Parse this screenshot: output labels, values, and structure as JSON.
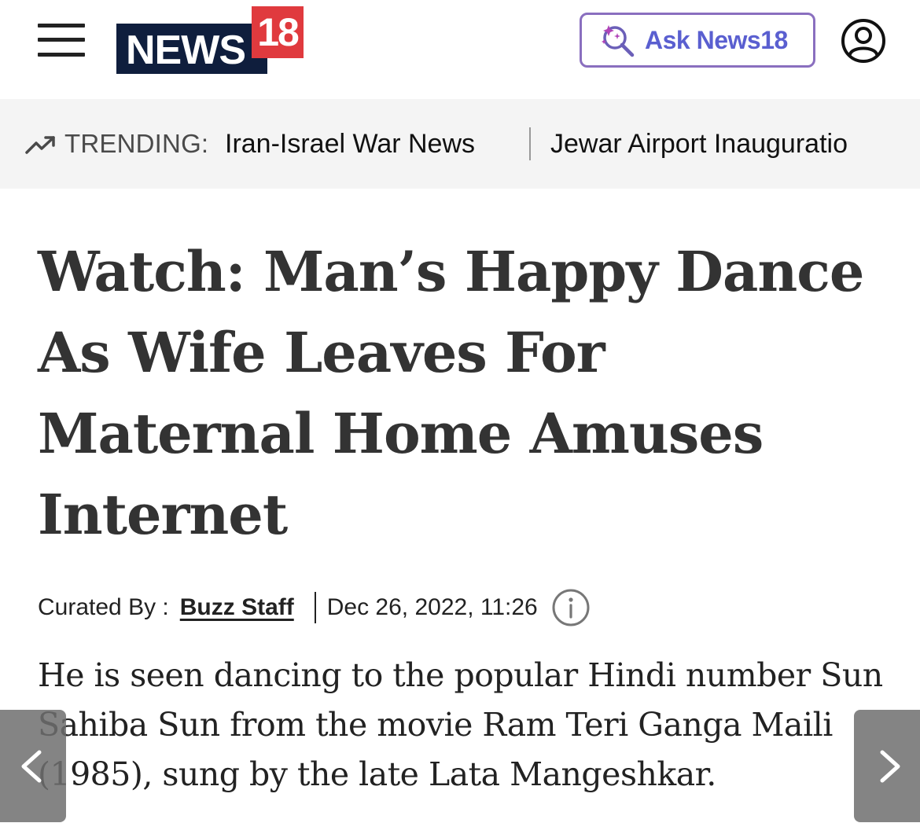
{
  "header": {
    "logo_word": "NEWS",
    "logo_number": "18",
    "ask_label": "Ask News18",
    "colors": {
      "logo_navy": "#0f1e3d",
      "logo_red": "#e03a3e",
      "ask_text": "#5a5fd0"
    }
  },
  "trending": {
    "label": "TRENDING:",
    "items": [
      "Iran-Israel War News",
      "Jewar Airport Inauguratio"
    ]
  },
  "article": {
    "headline": "Watch: Man’s Happy Dance As Wife Leaves For Maternal Home Amuses Internet",
    "curated_by_label": "Curated By :",
    "author": "Buzz Staff",
    "date": "Dec 26, 2022, 11:26",
    "summary": "He is seen dancing to the popular Hindi number Sun Sahiba Sun from the movie Ram Teri Ganga Maili (1985), sung by the late Lata Mangeshkar."
  },
  "icons": {
    "menu": "hamburger-menu-icon",
    "ask": "sparkle-search-icon",
    "user": "user-account-icon",
    "trending": "trending-up-icon",
    "info": "info-icon",
    "prev": "chevron-left-icon",
    "next": "chevron-right-icon"
  }
}
